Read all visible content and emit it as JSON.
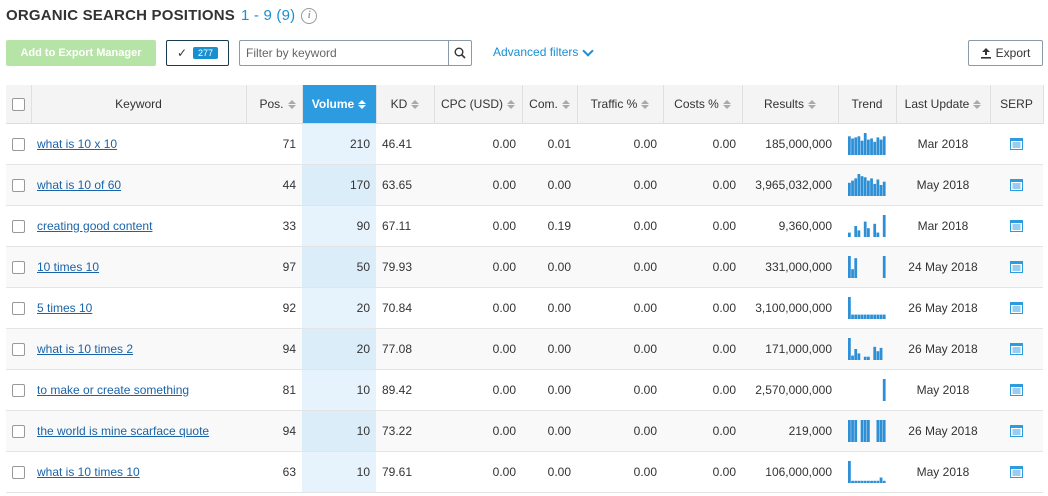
{
  "header": {
    "title": "ORGANIC SEARCH POSITIONS",
    "range": "1 - 9 (9)",
    "info": "i"
  },
  "toolbar": {
    "export_manager_label": "Add to Export Manager",
    "selected_count": "277",
    "filter_placeholder": "Filter by keyword",
    "advanced_filters_label": "Advanced filters",
    "export_label": "Export"
  },
  "table": {
    "columns": [
      "Keyword",
      "Pos.",
      "Volume",
      "KD",
      "CPC (USD)",
      "Com.",
      "Traffic %",
      "Costs %",
      "Results",
      "Trend",
      "Last Update",
      "SERP"
    ],
    "rows": [
      {
        "keyword": "what is 10 x 10",
        "pos": "71",
        "volume": "210",
        "kd": "46.41",
        "cpc": "0.00",
        "com": "0.01",
        "traffic": "0.00",
        "costs": "0.00",
        "results": "185,000,000",
        "trend": [
          0.85,
          0.75,
          0.8,
          0.85,
          0.65,
          1,
          0.7,
          0.75,
          0.6,
          0.8,
          0.7,
          0.85
        ],
        "last_update": "Mar 2018"
      },
      {
        "keyword": "what is 10 of 60",
        "pos": "44",
        "volume": "170",
        "kd": "63.65",
        "cpc": "0.00",
        "com": "0.00",
        "traffic": "0.00",
        "costs": "0.00",
        "results": "3,965,032,000",
        "trend": [
          0.6,
          0.7,
          0.8,
          1,
          0.9,
          0.85,
          0.7,
          0.8,
          0.55,
          0.75,
          0.5,
          0.65
        ],
        "last_update": "May 2018"
      },
      {
        "keyword": "creating good content",
        "pos": "33",
        "volume": "90",
        "kd": "67.11",
        "cpc": "0.00",
        "com": "0.19",
        "traffic": "0.00",
        "costs": "0.00",
        "results": "9,360,000",
        "trend": [
          0.2,
          0,
          0.5,
          0.3,
          0,
          0.7,
          0.4,
          0,
          0.6,
          0.2,
          0,
          1
        ],
        "last_update": "Mar 2018"
      },
      {
        "keyword": "10 times 10",
        "pos": "97",
        "volume": "50",
        "kd": "79.93",
        "cpc": "0.00",
        "com": "0.00",
        "traffic": "0.00",
        "costs": "0.00",
        "results": "331,000,000",
        "trend": [
          1,
          0.4,
          0.9,
          0,
          0,
          0,
          0,
          0,
          0,
          0,
          0,
          1
        ],
        "last_update": "24 May 2018"
      },
      {
        "keyword": "5 times 10",
        "pos": "92",
        "volume": "20",
        "kd": "70.84",
        "cpc": "0.00",
        "com": "0.00",
        "traffic": "0.00",
        "costs": "0.00",
        "results": "3,100,000,000",
        "trend": [
          1,
          0.2,
          0.2,
          0.2,
          0.2,
          0.2,
          0.2,
          0.2,
          0.2,
          0.2,
          0.2,
          0.2
        ],
        "last_update": "26 May 2018"
      },
      {
        "keyword": "what is 10 times 2",
        "pos": "94",
        "volume": "20",
        "kd": "77.08",
        "cpc": "0.00",
        "com": "0.00",
        "traffic": "0.00",
        "costs": "0.00",
        "results": "171,000,000",
        "trend": [
          1,
          0.2,
          0.5,
          0.3,
          0,
          0.15,
          0.15,
          0,
          0.6,
          0.4,
          0.55,
          0
        ],
        "last_update": "26 May 2018"
      },
      {
        "keyword": "to make or create something",
        "pos": "81",
        "volume": "10",
        "kd": "89.42",
        "cpc": "0.00",
        "com": "0.00",
        "traffic": "0.00",
        "costs": "0.00",
        "results": "2,570,000,000",
        "trend": [
          0,
          0,
          0,
          0,
          0,
          0,
          0,
          0,
          0,
          0,
          0,
          1
        ],
        "last_update": "May 2018"
      },
      {
        "keyword": "the world is mine scarface quote",
        "pos": "94",
        "volume": "10",
        "kd": "73.22",
        "cpc": "0.00",
        "com": "0.00",
        "traffic": "0.00",
        "costs": "0.00",
        "results": "219,000",
        "trend": [
          1,
          1,
          1,
          0,
          1,
          1,
          1,
          0,
          0,
          1,
          1,
          1
        ],
        "last_update": "26 May 2018"
      },
      {
        "keyword": "what is 10 times 10",
        "pos": "63",
        "volume": "10",
        "kd": "79.61",
        "cpc": "0.00",
        "com": "0.00",
        "traffic": "0.00",
        "costs": "0.00",
        "results": "106,000,000",
        "trend": [
          1,
          0.1,
          0.1,
          0.1,
          0.1,
          0.1,
          0.1,
          0.1,
          0.1,
          0.1,
          0.25,
          0.1
        ],
        "last_update": "May 2018"
      }
    ]
  },
  "colors": {
    "accent": "#2d9be0",
    "link": "#1a63a8",
    "export_manager_bg": "#b6e3a6",
    "trend_bar": "#2d8fd6"
  },
  "icons": {
    "info": "info-icon",
    "check": "check-icon",
    "search": "search-icon",
    "chevron": "chevron-down-icon",
    "export": "export-icon",
    "serp": "serp-icon",
    "sort": "sort-icon",
    "checkbox": "checkbox-icon"
  }
}
